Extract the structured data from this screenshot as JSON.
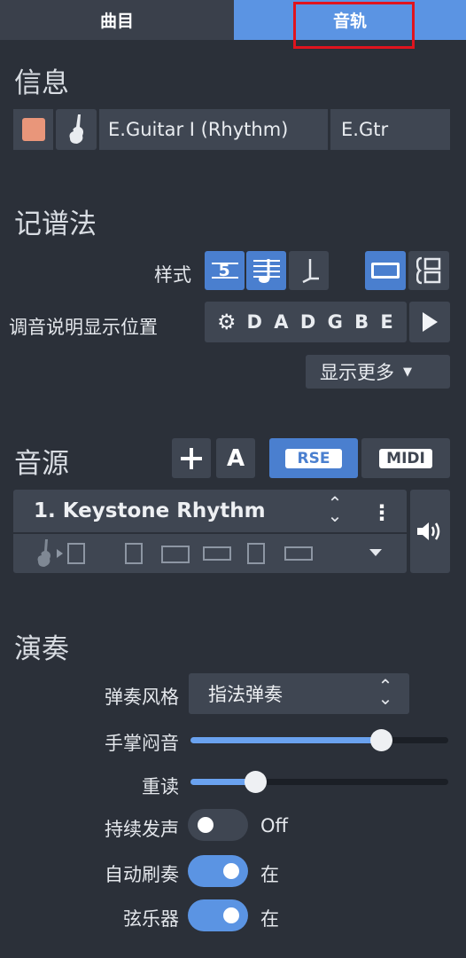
{
  "tabs": {
    "score": "曲目",
    "track": "音轨"
  },
  "info": {
    "title": "信息",
    "color": "#e9967a",
    "instrument_icon": "electric-guitar-icon",
    "track_name": "E.Guitar I (Rhythm)",
    "short_name": "E.Gtr"
  },
  "notation": {
    "title": "记谱法",
    "style_label": "样式",
    "style_tab": "5",
    "tuning_label": "调音说明显示位置",
    "tuning_value": "D A D G B E",
    "show_more": "显示更多"
  },
  "sound": {
    "title": "音源",
    "add_icon": "plus-icon",
    "auto_label": "A",
    "rse_label": "RSE",
    "midi_label": "MIDI",
    "preset": "1. Keystone Rhythm"
  },
  "performance": {
    "title": "演奏",
    "style_label": "弹奏风格",
    "style_value": "指法弹奏",
    "palm_mute_label": "手掌闷音",
    "palm_mute_value": 0.74,
    "accent_label": "重读",
    "accent_value": 0.25,
    "sustain_label": "持续发声",
    "sustain_state": "Off",
    "auto_strum_label": "自动刷奏",
    "auto_strum_state": "在",
    "strings_label": "弦乐器",
    "strings_state": "在"
  }
}
